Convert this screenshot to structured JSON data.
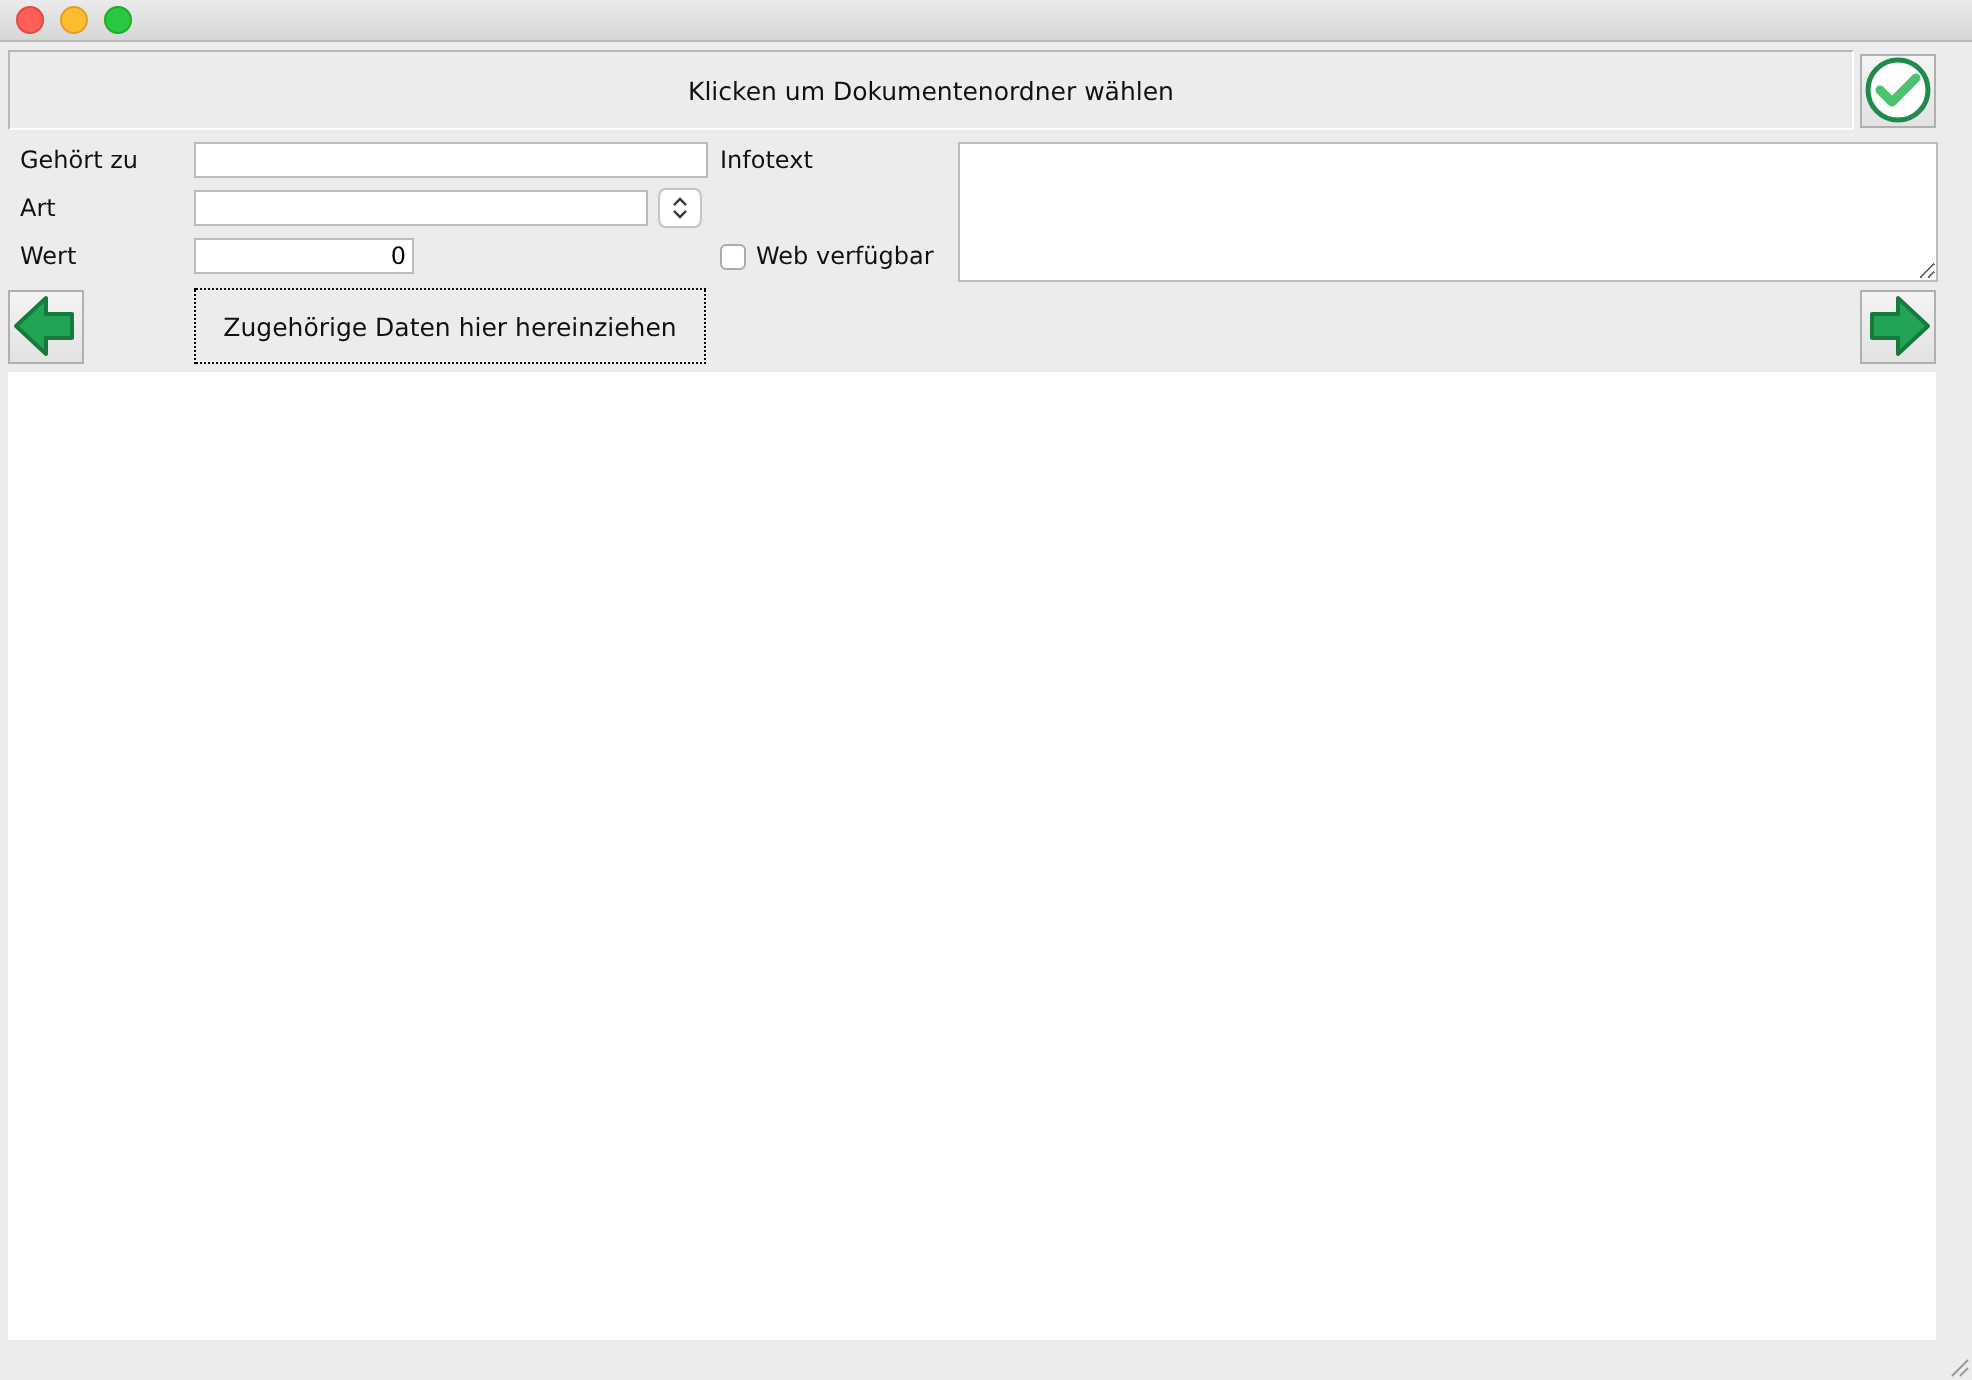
{
  "folder_button": {
    "label": "Klicken um Dokumentenordner wählen"
  },
  "fields": [
    {
      "kind": "text",
      "label": "Gehört zu"
    },
    {
      "kind": "combo",
      "label": "Art"
    },
    {
      "kind": "number",
      "label": "Wert",
      "value": "0"
    }
  ],
  "infotext": {
    "label": "Infotext"
  },
  "web_checkbox": {
    "label": "Web verfügbar",
    "checked": false
  },
  "drop_button": {
    "label": "Zugehörige Daten hier hereinziehen"
  }
}
